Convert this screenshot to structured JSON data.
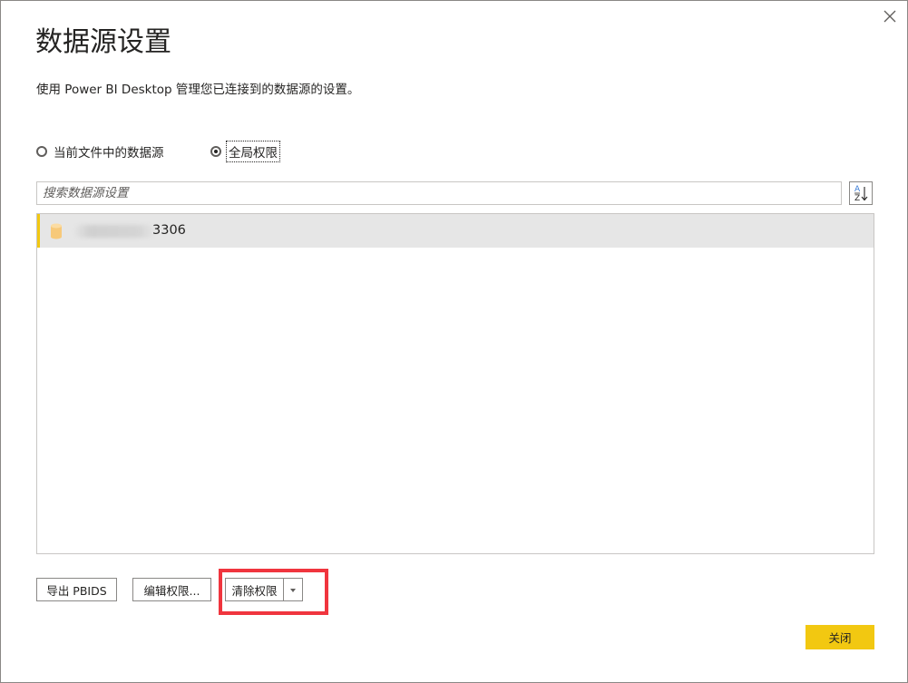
{
  "dialog": {
    "title": "数据源设置",
    "description": "使用 Power BI Desktop 管理您已连接到的数据源的设置。"
  },
  "scope": {
    "options": [
      {
        "label": "当前文件中的数据源",
        "selected": false
      },
      {
        "label": "全局权限",
        "selected": true
      }
    ]
  },
  "search": {
    "placeholder": "搜索数据源设置",
    "value": ""
  },
  "sort": {
    "icon": "sort-az-icon"
  },
  "sources": [
    {
      "icon": "database-icon",
      "label_visible": "3306",
      "highlight_color": "#f2c811"
    }
  ],
  "buttons": {
    "export": "导出 PBIDS",
    "edit": "编辑权限...",
    "clear": "清除权限",
    "close": "关闭"
  },
  "colors": {
    "accent": "#f2c811",
    "annotation": "#f0353e",
    "selected_row": "#e6e6e6"
  }
}
